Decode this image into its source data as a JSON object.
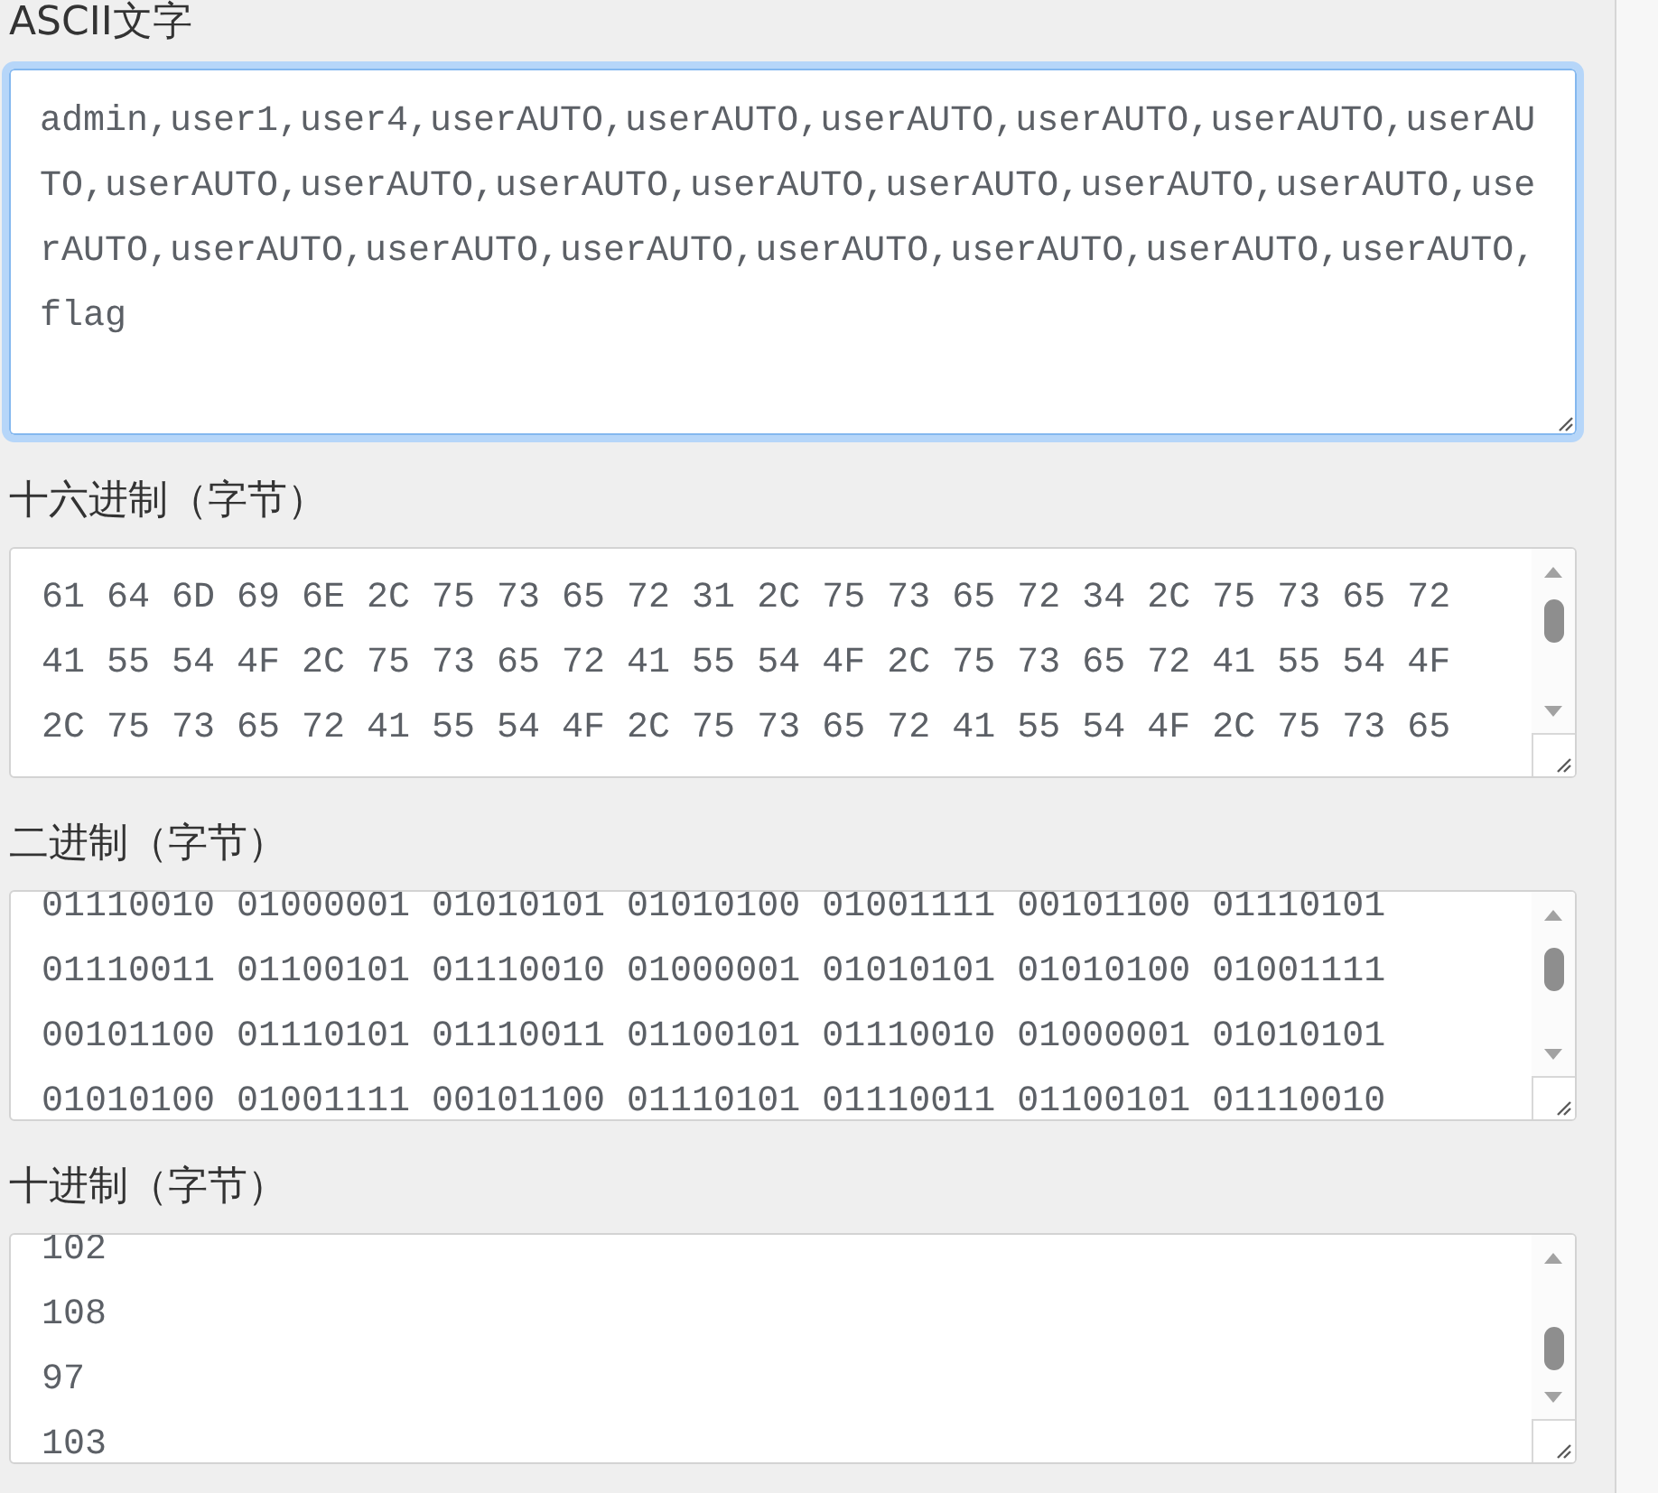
{
  "sections": [
    {
      "label": "ASCII文字",
      "field": {
        "value": "admin,user1,user4,userAUTO,userAUTO,userAUTO,userAUTO,userAUTO,userAUTO,userAUTO,userAUTO,userAUTO,userAUTO,userAUTO,userAUTO,userAUTO,userAUTO,userAUTO,userAUTO,userAUTO,userAUTO,userAUTO,userAUTO,userAUTO,flag",
        "focused": true,
        "scrollbar": false
      }
    },
    {
      "label": "十六进制（字节）",
      "field": {
        "value": "61 64 6D 69 6E 2C 75 73 65 72 31 2C 75 73 65 72 34 2C 75 73 65 72 41 55 54 4F 2C 75 73 65 72 41 55 54 4F 2C 75 73 65 72 41 55 54 4F 2C 75 73 65 72 41 55 54 4F 2C 75 73 65 72 41 55 54 4F 2C 75 73 65",
        "focused": false,
        "scrollbar": true
      }
    },
    {
      "label": "二进制（字节）",
      "field": {
        "value": "01110010 01000001 01010101 01010100 01001111 00101100 01110101 01110011 01100101 01110010 01000001 01010101 01010100 01001111 00101100 01110101 01110011 01100101 01110010 01000001 01010101 01010100 01001111 00101100 01110101 01110011 01100101 01110010",
        "focused": false,
        "scrollbar": true
      }
    },
    {
      "label": "十进制（字节）",
      "field": {
        "value": "102\n108\n97\n103",
        "focused": false,
        "scrollbar": true
      }
    }
  ]
}
